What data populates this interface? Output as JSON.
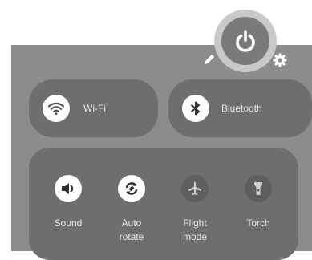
{
  "colors": {
    "panel_bg": "#8c8c8c",
    "tile_bg": "#6e6e6e",
    "icon_on_bg": "#ffffff",
    "icon_off_bg": "#5e5e5e",
    "power_button": "#7a7a7a",
    "power_halo": "#c9c9c9"
  },
  "header": {
    "icons": [
      "pencil-icon",
      "power-icon",
      "gear-icon"
    ]
  },
  "tiles": {
    "wifi": {
      "label": "Wi-Fi",
      "icon": "wifi-icon",
      "state": "on"
    },
    "bluetooth": {
      "label": "Bluetooth",
      "icon": "bluetooth-icon",
      "state": "on"
    }
  },
  "grid": {
    "items": [
      {
        "label": "Sound",
        "icon": "speaker-icon",
        "state": "on"
      },
      {
        "label": "Auto\nrotate",
        "icon": "rotate-icon",
        "state": "on"
      },
      {
        "label": "Flight\nmode",
        "icon": "airplane-icon",
        "state": "off"
      },
      {
        "label": "Torch",
        "icon": "flashlight-icon",
        "state": "off"
      }
    ]
  }
}
